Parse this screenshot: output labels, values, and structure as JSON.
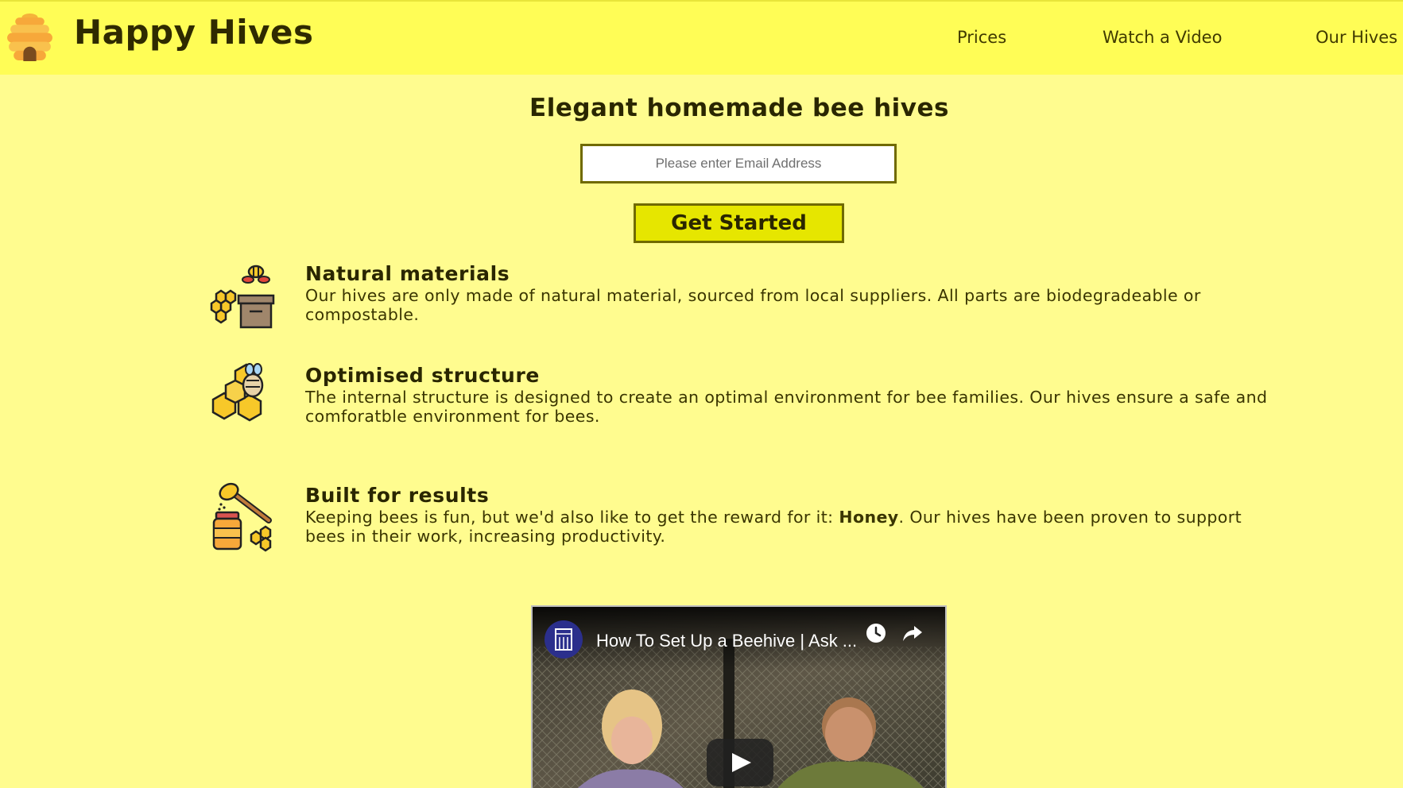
{
  "header": {
    "brand": "Happy Hives",
    "nav": [
      {
        "label": "Prices"
      },
      {
        "label": "Watch a Video"
      },
      {
        "label": "Our Hives"
      }
    ]
  },
  "hero": {
    "title": "Elegant homemade bee hives",
    "email_placeholder": "Please enter Email Address",
    "cta_label": "Get Started"
  },
  "features": [
    {
      "icon": "bee-box-icon",
      "title": "Natural materials",
      "text": "Our hives are only made of natural material, sourced from local suppliers. All parts are biodegradeable or compostable."
    },
    {
      "icon": "bee-honeycomb-icon",
      "title": "Optimised structure",
      "text": "The internal structure is designed to create an optimal environment for bee families. Our hives ensure a safe and comforatble environment for bees."
    },
    {
      "icon": "honey-jar-icon",
      "title": "Built for results",
      "text_before": "Keeping bees is fun, but we'd also like to get the reward for it: ",
      "text_bold": "Honey",
      "text_after": ". Our hives have been proven to support bees in their work, increasing productivity."
    }
  ],
  "video": {
    "title": "How To Set Up a Beehive | Ask ...",
    "icons": [
      "channel-avatar-icon",
      "watch-later-icon",
      "share-icon",
      "play-icon"
    ]
  },
  "colors": {
    "page_bg": "#fffc8f",
    "header_bg": "#fffd56",
    "button_bg": "#e6e600",
    "border": "#706a00",
    "text": "#2a2600"
  }
}
